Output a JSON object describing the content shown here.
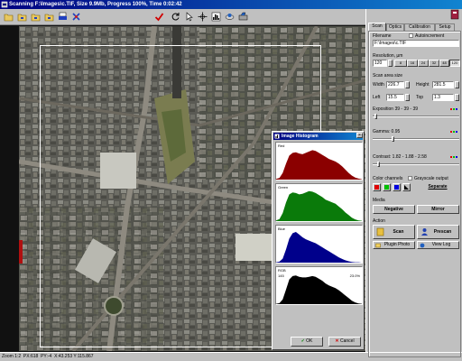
{
  "window": {
    "title": "Scanning F:\\Images\\c.TIF, Size 9.9Mb, Progress 100%, Time 0:02:42"
  },
  "toolbar": {
    "buttons": [
      "open-folder-icon",
      "open-folder-icon",
      "open-folder-icon",
      "open-folder-icon",
      "print-icon",
      "delete-icon",
      "checkmark-icon",
      "rotate-icon",
      "pointer-icon",
      "crosshair-icon",
      "histogram-icon",
      "satellite-icon",
      "scanner-icon"
    ]
  },
  "status": {
    "zoom": "Zoom 1:2",
    "px": "PX:618",
    "py": "PY:-4",
    "coords": "X:43.253 Y:115.867"
  },
  "panel": {
    "tabs": [
      {
        "label": "Scan",
        "active": true
      },
      {
        "label": "Optics",
        "active": false
      },
      {
        "label": "Calibration",
        "active": false
      },
      {
        "label": "Setup",
        "active": false
      }
    ],
    "filename_label": "Filename",
    "autoincrement_label": "Autoincrement",
    "filename_value": "F:\\Images\\c.TIF",
    "resolution_label": "Resolution, µm",
    "resolution_value": "120",
    "resolution_presets": [
      "8",
      "16",
      "24",
      "32",
      "48",
      "120"
    ],
    "resolution_active": "120",
    "scan_area_label": "Scan area size",
    "width_label": "Width",
    "width_value": "226.7",
    "height_label": "Height",
    "height_value": "281.5",
    "left_label": "Left",
    "left_value": "15.5",
    "top_label": "Top",
    "top_value": "1.3",
    "exposition_label": "Exposition 39 - 39 - 39",
    "exposition_level": 0.02,
    "gamma_label": "Gamma: 0.95",
    "gamma_level": 0.23,
    "contrast_label": "Contrast: 1.82 - 1.88 - 2.58",
    "contrast_level": 0.05,
    "color_channels_label": "Color channels",
    "grayscale_label": "Grayscale output",
    "channel_colors": [
      "#e00000",
      "#00c000",
      "#0000e0"
    ],
    "separate_label": "Separate",
    "media_label": "Media",
    "negative_label": "Negative",
    "mirror_label": "Mirror",
    "action_label": "Action",
    "scan_label": "Scan",
    "prescan_label": "Prescan",
    "plugin_label": "Plugin Photo",
    "viewlog_label": "View Log"
  },
  "histogram": {
    "title": "Image Histogram",
    "close_glyph": "×",
    "ok_label": "OK",
    "cancel_label": "Cancel",
    "rgb_left": "145",
    "rgb_right": "23.0%",
    "panels": [
      {
        "label": "Red",
        "color": "#8b0000",
        "values": [
          2,
          5,
          20,
          48,
          72,
          80,
          82,
          78,
          76,
          80,
          84,
          88,
          86,
          80,
          74,
          68,
          62,
          58,
          54,
          48,
          40,
          30,
          20,
          12,
          6,
          3,
          1
        ]
      },
      {
        "label": "Green",
        "color": "#0a7a0a",
        "values": [
          2,
          6,
          24,
          56,
          80,
          86,
          84,
          80,
          82,
          86,
          90,
          88,
          84,
          78,
          72,
          64,
          60,
          56,
          52,
          44,
          36,
          26,
          18,
          10,
          5,
          2,
          1
        ]
      },
      {
        "label": "Blue",
        "color": "#00008b",
        "values": [
          1,
          3,
          12,
          40,
          72,
          88,
          92,
          84,
          76,
          70,
          66,
          62,
          58,
          52,
          46,
          40,
          34,
          28,
          22,
          16,
          11,
          7,
          4,
          2,
          1,
          1,
          0
        ]
      },
      {
        "label": "RGB",
        "color": "#000000",
        "values": [
          1,
          3,
          14,
          44,
          74,
          84,
          86,
          82,
          80,
          80,
          82,
          84,
          82,
          76,
          70,
          62,
          56,
          52,
          48,
          42,
          34,
          26,
          18,
          10,
          5,
          2,
          1
        ]
      }
    ]
  }
}
